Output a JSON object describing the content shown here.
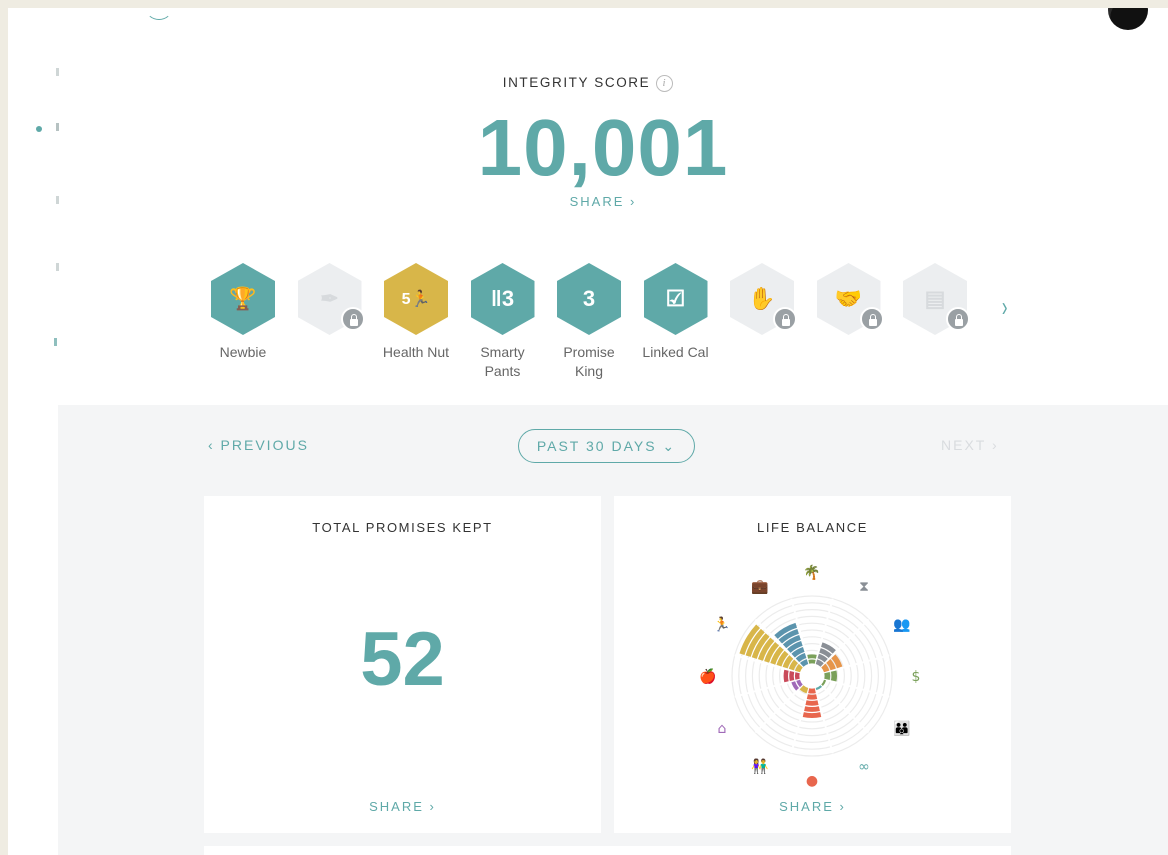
{
  "integrity": {
    "label": "INTEGRITY SCORE",
    "info_glyph": "i",
    "score": "10,001",
    "share": "SHARE ›"
  },
  "badges": [
    {
      "label": "Newbie",
      "glyph": "🏆",
      "color": "teal",
      "locked": false
    },
    {
      "label": "",
      "glyph": "✒",
      "color": "gray",
      "locked": true
    },
    {
      "label": "Health Nut",
      "glyph": "5🏃",
      "color": "gold",
      "locked": false
    },
    {
      "label": "Smarty Pants",
      "glyph": "‖3",
      "color": "teal",
      "locked": false
    },
    {
      "label": "Promise King",
      "glyph": "3",
      "color": "teal",
      "locked": false
    },
    {
      "label": "Linked Cal",
      "glyph": "☑",
      "color": "teal",
      "locked": false
    },
    {
      "label": "",
      "glyph": "✋",
      "color": "gray",
      "locked": true
    },
    {
      "label": "",
      "glyph": "🤝",
      "color": "gray",
      "locked": true
    },
    {
      "label": "",
      "glyph": "▤",
      "color": "gray",
      "locked": true
    }
  ],
  "nav": {
    "previous": "‹  PREVIOUS",
    "period": "PAST 30 DAYS  ⌄",
    "next": "NEXT  ›"
  },
  "cards": {
    "promises": {
      "title": "TOTAL PROMISES KEPT",
      "value": "52",
      "share": "SHARE  ›"
    },
    "balance": {
      "title": "LIFE BALANCE",
      "share": "SHARE  ›"
    }
  },
  "life_balance": {
    "categories": [
      {
        "icon": "palm-tree-icon",
        "glyph": "🌴",
        "color": "#7aa05a",
        "level": 0.15
      },
      {
        "icon": "hourglass-icon",
        "glyph": "⧗",
        "color": "#8a8f96",
        "level": 0.35
      },
      {
        "icon": "people-icon",
        "glyph": "👥",
        "color": "#e6954a",
        "level": 0.3
      },
      {
        "icon": "dollar-icon",
        "glyph": "$",
        "color": "#7aa05a",
        "level": 0.2
      },
      {
        "icon": "family-icon",
        "glyph": "👪",
        "color": "#7aa05a",
        "level": 0.05
      },
      {
        "icon": "infinity-icon",
        "glyph": "∞",
        "color": "#5fa9a8",
        "level": 0.05
      },
      {
        "icon": "brain-icon",
        "glyph": "●",
        "color": "#e8664d",
        "level": 0.45
      },
      {
        "icon": "couple-icon",
        "glyph": "👫",
        "color": "#d8b649",
        "level": 0.1
      },
      {
        "icon": "home-icon",
        "glyph": "⌂",
        "color": "#a06ab8",
        "level": 0.15
      },
      {
        "icon": "apple-icon",
        "glyph": "🍎",
        "color": "#c94a5a",
        "level": 0.25
      },
      {
        "icon": "runner-icon",
        "glyph": "🏃",
        "color": "#d8b649",
        "level": 0.95
      },
      {
        "icon": "briefcase-icon",
        "glyph": "💼",
        "color": "#5b94ad",
        "level": 0.65
      }
    ]
  }
}
